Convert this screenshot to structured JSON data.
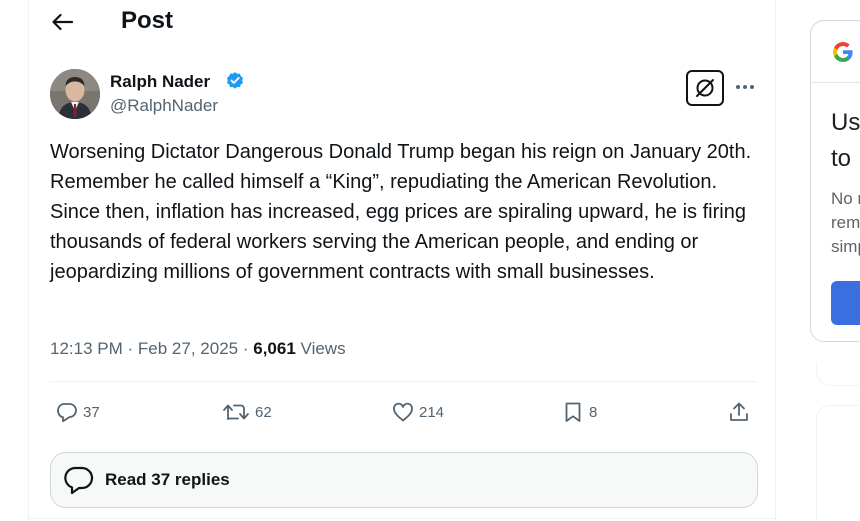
{
  "header": {
    "title": "Post"
  },
  "author": {
    "name": "Ralph Nader",
    "handle": "@RalphNader"
  },
  "post": {
    "text": "Worsening Dictator Dangerous Donald Trump began his reign on January 20th. Remember he called himself a “King”, repudiating the American Revolution. Since then, inflation has increased, egg prices are spiraling upward, he is firing thousands of federal workers serving the American people, and ending or jeopardizing millions of government contracts with small businesses.",
    "time": "12:13 PM",
    "date": "Feb 27, 2025",
    "views_count": "6,061",
    "views_label": "Views",
    "separator": "·"
  },
  "actions": {
    "replies": "37",
    "reposts": "62",
    "likes": "214",
    "bookmarks": "8"
  },
  "read_replies": {
    "label": "Read 37 replies"
  },
  "sidebar": {
    "heading_line1": "Us",
    "heading_line2": "to",
    "body_line1": "No r",
    "body_line2": "rem",
    "body_line3": "simp"
  },
  "colors": {
    "text": "#0f1419",
    "muted": "#536471",
    "verified": "#1d9bf0",
    "button_blue": "#3b6fe0"
  },
  "icons": {
    "back": "arrow-left-icon",
    "verified": "verified-badge-icon",
    "grok": "grok-icon",
    "more": "more-dots-icon",
    "reply": "reply-icon",
    "repost": "repost-icon",
    "like": "heart-icon",
    "bookmark": "bookmark-icon",
    "share": "share-icon",
    "replies_bubble": "replies-bubble-icon",
    "google": "google-logo-icon"
  }
}
